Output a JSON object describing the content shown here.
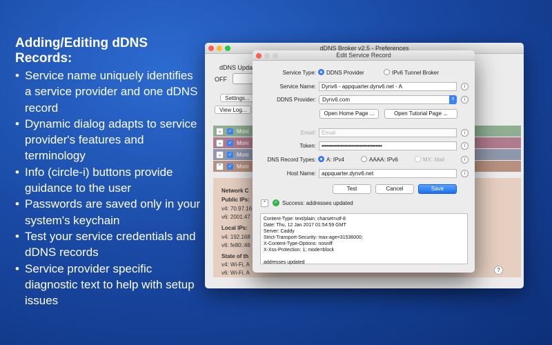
{
  "promo": {
    "heading": "Adding/Editing dDNS Records:",
    "bullets": [
      "Service name uniquely identifies a service provider and one dDNS record",
      "Dynamic dialog adapts to service provider's features and terminology",
      "Info (circle-i) buttons provide guidance to the user",
      "Passwords are saved only in your system's keychain",
      "Test your service credentials and dDNS records",
      "Service provider specific diagnostic text to help with setup issues"
    ]
  },
  "prefs_window": {
    "title": "dDNS Broker v2.5 - Preferences",
    "group_label": "dDNS Upda",
    "toggle_label": "OFF",
    "settings_button": "Settings...",
    "viewlog_button": "View Log...",
    "row_label": "Moni",
    "row_colors": [
      "#8fae92",
      "#b07b8c",
      "#8e97ab",
      "#b8907f"
    ],
    "network": {
      "title": "Network C",
      "public_ips_label": "Public IPs:",
      "public_v4": "v4: 70.97.16",
      "public_v6": "v6: 2001:47",
      "local_ips_label": "Local IPs:",
      "local_v4": "v4: 192.168",
      "local_v6": "v6: fe80::46",
      "state_label": "State of th",
      "state_v4": "v4: Wi-Fi, A",
      "state_v6": "v6: Wi-Fi, A"
    },
    "help_icon": "?"
  },
  "dialog": {
    "title": "Edit Service Record",
    "service_type_label": "Service Type:",
    "service_type_options": [
      "DDNS Provider",
      "IPv6 Tunnel Broker"
    ],
    "service_name_label": "Service Name:",
    "service_name_value": "Dynv6 - appquarter.dynv6.net - A",
    "ddns_provider_label": "DDNS Provider:",
    "ddns_provider_value": "Dynv6.com",
    "open_home_button": "Open Home Page ...",
    "open_tutorial_button": "Open Tutorial Page ...",
    "email_label": "Email:",
    "email_placeholder": "Email",
    "token_label": "Token:",
    "token_value": "••••••••••••••••••••••••••••••••••••••",
    "dns_record_types_label": "DNS Record Types:",
    "record_types": [
      "A: IPv4",
      "AAAA: IPv6",
      "MX: Mail"
    ],
    "host_name_label": "Host Name:",
    "host_name_value": "appquarter.dynv6.net",
    "test_button": "Test",
    "cancel_button": "Cancel",
    "save_button": "Save",
    "status_text": "Success: addresses updated",
    "diagnostic_lines": [
      "Content-Type: text/plain; charset=utf-8",
      "Date: Thu, 12 Jan 2017 01:54:59 GMT",
      "Server: Caddy",
      "Strict-Transport-Security: max-age=31536000;",
      "X-Content-Type-Options: nosniff",
      "X-Xss-Protection: 1; mode=block",
      "",
      "addresses updated"
    ],
    "info_icon": "i"
  }
}
